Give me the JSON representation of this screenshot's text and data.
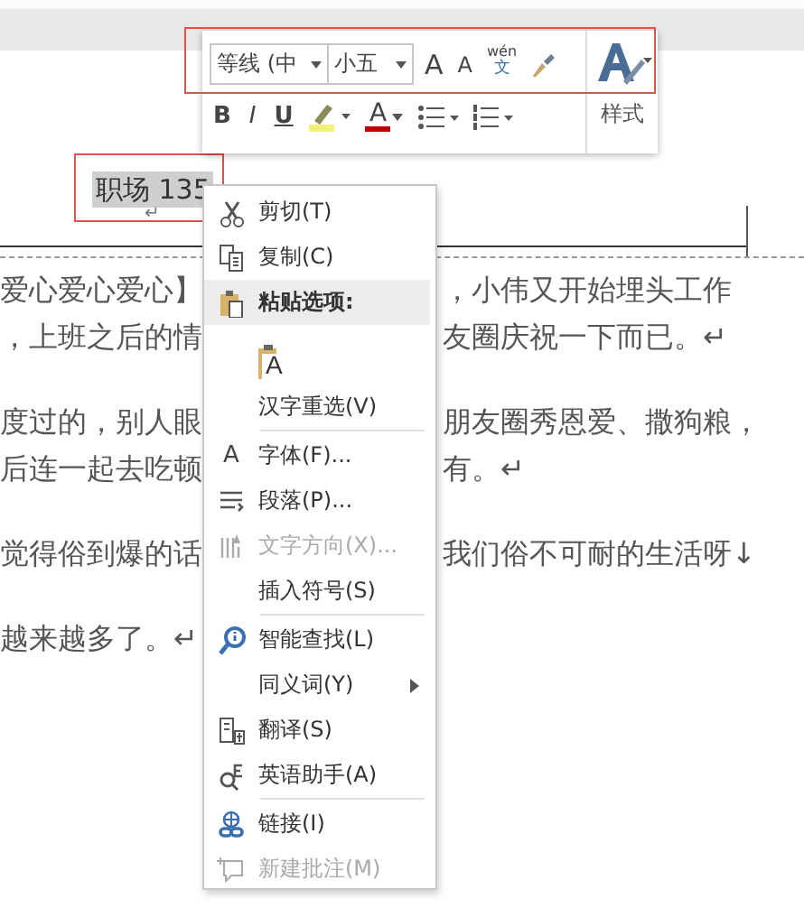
{
  "document": {
    "header": {
      "text": "职场 135",
      "selected": true,
      "annotated": true,
      "mark": "↵"
    },
    "paragraphs": [
      {
        "lines": [
          {
            "left": "爱心爱心爱心】",
            "right": "，小伟又开始埋头工作"
          },
          {
            "left": "，上班之后的情",
            "right": "友圈庆祝一下而已。↵"
          }
        ]
      },
      {
        "lines": [
          {
            "left": "度过的，别人眼",
            "right": "朋友圈秀恩爱、撒狗粮，"
          },
          {
            "left": "后连一起去吃顿",
            "right": "有。↵"
          }
        ]
      },
      {
        "lines": [
          {
            "left": "觉得俗到爆的话",
            "right": "我们俗不可耐的生活呀↓"
          }
        ]
      },
      {
        "lines": [
          {
            "left": "越来越多了。↵"
          }
        ]
      }
    ]
  },
  "mini_toolbar": {
    "annotated": true,
    "font": "等线 (中",
    "size": "小五",
    "grow_font": "A",
    "shrink_font": "A",
    "phonetic": {
      "top": "wén",
      "bottom": "文"
    },
    "bold": "B",
    "italic": "I",
    "underline": "U",
    "font_color": "A",
    "styles_label": "样式"
  },
  "context_menu": {
    "items": [
      {
        "label": "剪切(T)",
        "kind": "item",
        "disabled": false
      },
      {
        "label": "复制(C)",
        "kind": "item",
        "disabled": false
      },
      {
        "label": "粘贴选项:",
        "kind": "header",
        "disabled": false
      },
      {
        "kind": "paste",
        "glyph": "A"
      },
      {
        "label": "汉字重选(V)",
        "kind": "item",
        "disabled": false
      },
      {
        "label": "字体(F)...",
        "kind": "item",
        "disabled": false,
        "separator_before": true,
        "glyph": "A"
      },
      {
        "label": "段落(P)...",
        "kind": "item",
        "disabled": false
      },
      {
        "label": "文字方向(X)...",
        "kind": "item",
        "disabled": true
      },
      {
        "label": "插入符号(S)",
        "kind": "item",
        "disabled": false
      },
      {
        "label": "智能查找(L)",
        "kind": "item",
        "disabled": false,
        "separator_before": true
      },
      {
        "label": "同义词(Y)",
        "kind": "item",
        "disabled": false,
        "submenu": true
      },
      {
        "label": "翻译(S)",
        "kind": "item",
        "disabled": false
      },
      {
        "label": "英语助手(A)",
        "kind": "item",
        "disabled": false
      },
      {
        "label": "链接(I)",
        "kind": "item",
        "disabled": false,
        "separator_before": true
      },
      {
        "label": "新建批注(M)",
        "kind": "item",
        "disabled": true
      }
    ]
  }
}
